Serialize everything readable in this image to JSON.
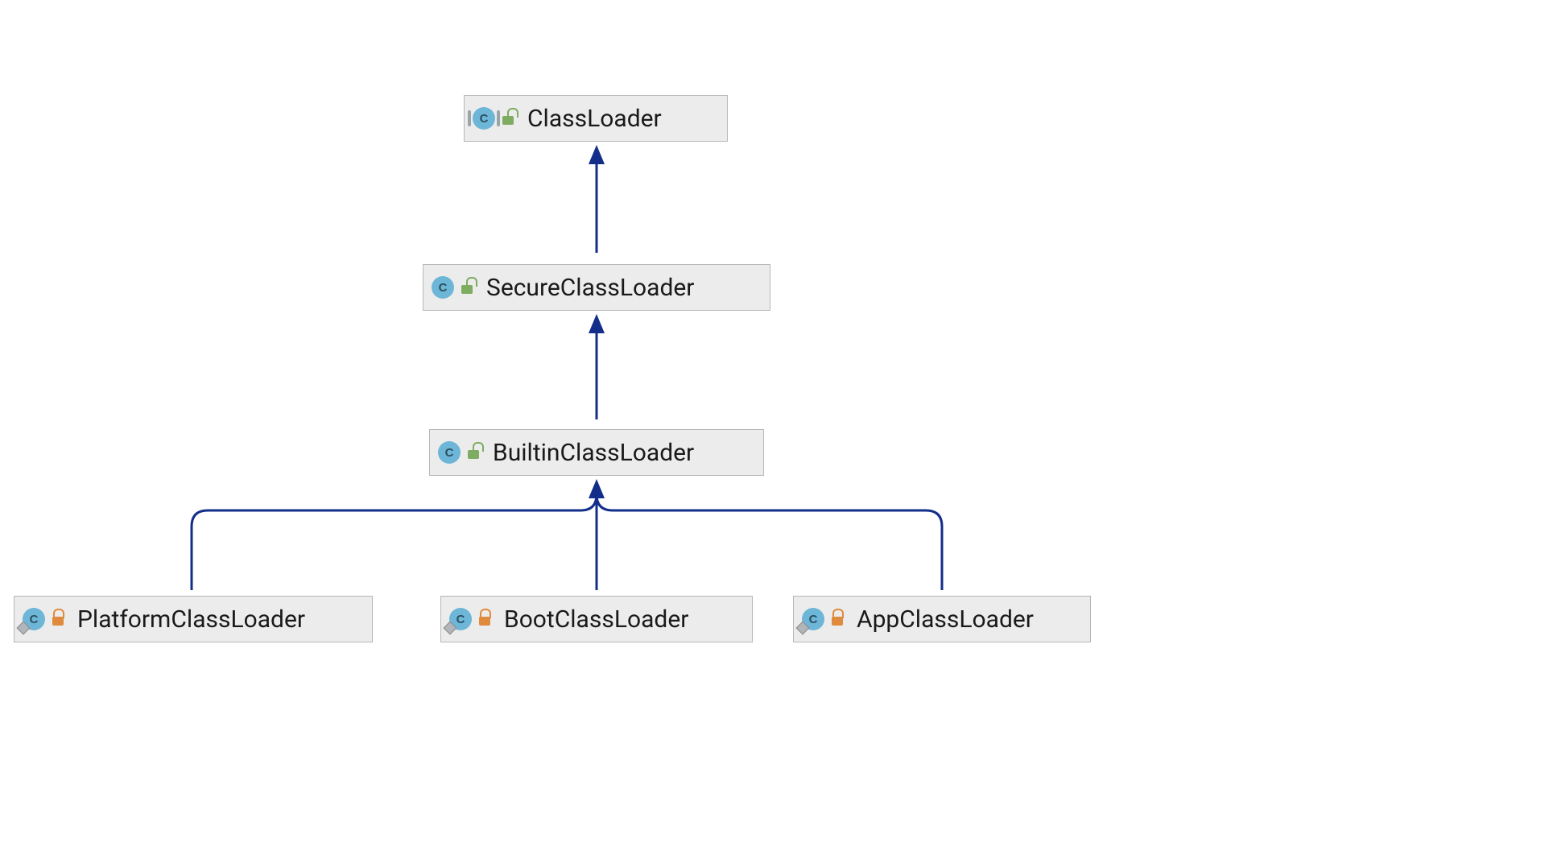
{
  "diagram": {
    "nodes": {
      "classloader": {
        "label": "ClassLoader",
        "abstract": true,
        "inner": false,
        "lock": "open"
      },
      "secureclassloader": {
        "label": "SecureClassLoader",
        "abstract": false,
        "inner": false,
        "lock": "open"
      },
      "builtinclassloader": {
        "label": "BuiltinClassLoader",
        "abstract": false,
        "inner": false,
        "lock": "open"
      },
      "platformclassloader": {
        "label": "PlatformClassLoader",
        "abstract": false,
        "inner": true,
        "lock": "closed"
      },
      "bootclassloader": {
        "label": "BootClassLoader",
        "abstract": false,
        "inner": true,
        "lock": "closed"
      },
      "appclassloader": {
        "label": "AppClassLoader",
        "abstract": false,
        "inner": true,
        "lock": "closed"
      }
    },
    "edges": [
      {
        "from": "secureclassloader",
        "to": "classloader"
      },
      {
        "from": "builtinclassloader",
        "to": "secureclassloader"
      },
      {
        "from": "platformclassloader",
        "to": "builtinclassloader"
      },
      {
        "from": "bootclassloader",
        "to": "builtinclassloader"
      },
      {
        "from": "appclassloader",
        "to": "builtinclassloader"
      }
    ],
    "colors": {
      "arrow": "#132e8a",
      "node_bg": "#ececec",
      "node_border": "#b7b7b7",
      "class_icon": "#6db6d8",
      "lock_open": "#7eac61",
      "lock_closed": "#e08a3e"
    }
  }
}
